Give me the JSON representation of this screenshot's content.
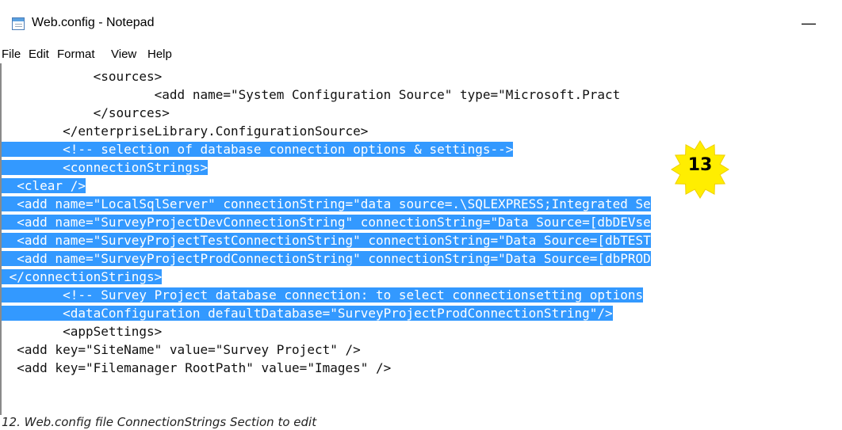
{
  "window": {
    "title": "Web.config - Notepad",
    "icon": "notepad-icon",
    "minimize_glyph": "—"
  },
  "menu": [
    "File",
    "Edit",
    "Format",
    "View",
    "Help"
  ],
  "editor": {
    "selection_color": "#3399ff",
    "lines": [
      {
        "text": "            <sources>",
        "selected": false
      },
      {
        "text": "                    <add name=\"System Configuration Source\" type=\"Microsoft.Pract",
        "selected": false
      },
      {
        "text": "            </sources>",
        "selected": false
      },
      {
        "text": "        </enterpriseLibrary.ConfigurationSource>",
        "selected": false
      },
      {
        "text": "        <!-- selection of database connection options & settings-->",
        "selected": true
      },
      {
        "text": "        <connectionStrings>",
        "selected": true
      },
      {
        "text": "  <clear />",
        "selected": true
      },
      {
        "text": "  <add name=\"LocalSqlServer\" connectionString=\"data source=.\\SQLEXPRESS;Integrated Se",
        "selected": true
      },
      {
        "text": "  <add name=\"SurveyProjectDevConnectionString\" connectionString=\"Data Source=[dbDEVse",
        "selected": true
      },
      {
        "text": "  <add name=\"SurveyProjectTestConnectionString\" connectionString=\"Data Source=[dbTEST",
        "selected": true
      },
      {
        "text": "  <add name=\"SurveyProjectProdConnectionString\" connectionString=\"Data Source=[dbPROD",
        "selected": true
      },
      {
        "text": " </connectionStrings>",
        "selected": true
      },
      {
        "text": "        <!-- Survey Project database connection: to select connectionsetting options",
        "selected": true
      },
      {
        "text": "        <dataConfiguration defaultDatabase=\"SurveyProjectProdConnectionString\"/>",
        "selected": true
      },
      {
        "text": "        <appSettings>",
        "selected": false
      },
      {
        "text": "  <add key=\"SiteName\" value=\"Survey Project\" />",
        "selected": false
      },
      {
        "text": "  <add key=\"Filemanager RootPath\" value=\"Images\" />",
        "selected": false
      }
    ]
  },
  "annotation": {
    "number": "13",
    "color": "#ffee00",
    "icon": "star-badge-icon"
  },
  "caption": "12. Web.config file ConnectionStrings Section to edit"
}
